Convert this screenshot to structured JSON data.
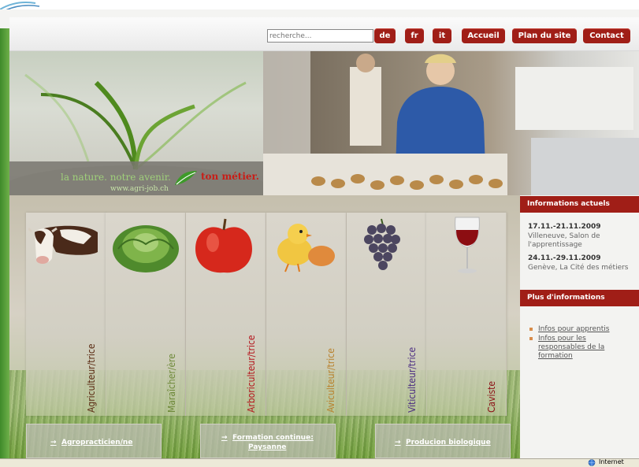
{
  "header": {
    "search_placeholder": "recherche...",
    "lang_buttons": [
      "de",
      "fr",
      "it"
    ],
    "nav_buttons": [
      "Accueil",
      "Plan du site",
      "Contact"
    ]
  },
  "banner": {
    "slogan_part1": "la nature. notre avenir.",
    "slogan_part2": "ton métier.",
    "url": "www.agri-job.ch"
  },
  "professions": [
    {
      "label": "Agriculteur/trice",
      "color": "#5a2a12"
    },
    {
      "label": "Maraîcher/ère",
      "color": "#6f8a3a"
    },
    {
      "label": "Arboriculteur/trice",
      "color": "#b4151c"
    },
    {
      "label": "Aviculteur/trice",
      "color": "#b9822e"
    },
    {
      "label": "Viticulteur/trice",
      "color": "#4b2c82"
    },
    {
      "label": "Caviste",
      "color": "#8c1216"
    }
  ],
  "sidebar": {
    "news_title": "Informations actuels",
    "news": [
      {
        "date": "17.11.-21.11.2009",
        "text": [
          "Villeneuve, Salon de",
          "l'apprentissage"
        ]
      },
      {
        "date": "24.11.-29.11.2009",
        "text": [
          "Genève, La Cité des métiers"
        ]
      }
    ],
    "more_title": "Plus d'informations",
    "links": [
      {
        "lines": [
          "Infos pour apprentis"
        ]
      },
      {
        "lines": [
          "Infos pour les",
          "responsables de la",
          "formation"
        ]
      }
    ]
  },
  "bottom_links": [
    {
      "lines": [
        "Agropracticien/ne"
      ]
    },
    {
      "lines": [
        "Formation continue:",
        "Paysanne"
      ]
    },
    {
      "lines": [
        "Producion biologique"
      ]
    }
  ],
  "status": {
    "zone": "Internet"
  }
}
